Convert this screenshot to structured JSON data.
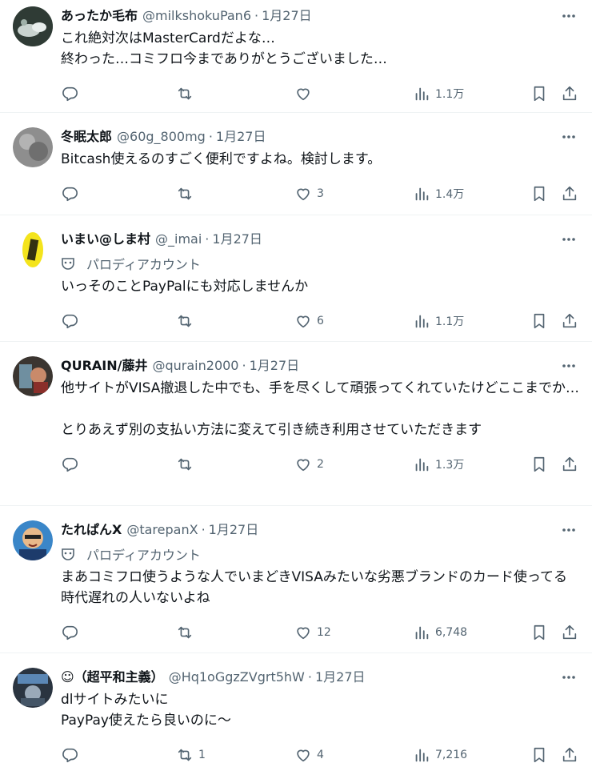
{
  "posts": [
    {
      "name": "あったか毛布",
      "handle": "@milkshokuPan6",
      "date": "1月27日",
      "parody": "",
      "text": "これ絶対次はMasterCardだよな…\n終わった…コミフロ今までありがとうございました…",
      "replies": "",
      "reposts": "",
      "likes": "",
      "views": "1.1万"
    },
    {
      "name": "冬眠太郎",
      "handle": "@60g_800mg",
      "date": "1月27日",
      "parody": "",
      "text": "Bitcash使えるのすごく便利ですよね。検討します。",
      "replies": "",
      "reposts": "",
      "likes": "3",
      "views": "1.4万"
    },
    {
      "name": "いまい@しま村",
      "handle": "@_imai",
      "date": "1月27日",
      "parody": "パロディアカウント",
      "text": "いっそのことPayPalにも対応しませんか",
      "replies": "",
      "reposts": "",
      "likes": "6",
      "views": "1.1万"
    },
    {
      "name": "QURAIN/藤井",
      "handle": "@qurain2000",
      "date": "1月27日",
      "parody": "",
      "text": "他サイトがVISA撤退した中でも、手を尽くして頑張ってくれていたけどここまでか…\n\nとりあえず別の支払い方法に変えて引き続き利用させていただきます",
      "replies": "",
      "reposts": "",
      "likes": "2",
      "views": "1.3万"
    },
    {
      "name": "たれぱんX",
      "handle": "@tarepanX",
      "date": "1月27日",
      "parody": "パロディアカウント",
      "text": "まあコミフロ使うような人でいまどきVISAみたいな劣悪ブランドのカード使ってる時代遅れの人いないよね",
      "replies": "",
      "reposts": "",
      "likes": "12",
      "views": "6,748"
    },
    {
      "name": "☺（超平和主義）",
      "handle": "@Hq1oGgzZVgrt5hW",
      "date": "1月27日",
      "parody": "",
      "text": "dlサイトみたいに\nPayPay使えたら良いのに～",
      "replies": "",
      "reposts": "1",
      "likes": "4",
      "views": "7,216"
    }
  ],
  "separator": "·",
  "icons": {
    "more": "more-dots-icon",
    "reply": "reply-icon",
    "repost": "repost-icon",
    "like": "heart-icon",
    "views": "views-chart-icon",
    "bookmark": "bookmark-icon",
    "share": "share-icon",
    "parody": "parody-mask-icon"
  },
  "colors": {
    "text": "#0f1419",
    "secondary": "#536471",
    "divider": "#eff3f4"
  }
}
